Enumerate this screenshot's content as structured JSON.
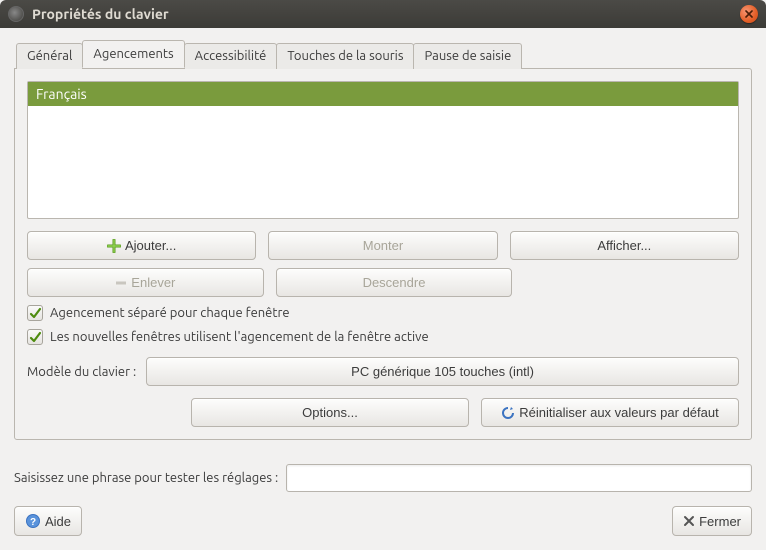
{
  "window": {
    "title": "Propriétés du clavier"
  },
  "tabs": [
    {
      "label": "Général"
    },
    {
      "label": "Agencements"
    },
    {
      "label": "Accessibilité"
    },
    {
      "label": "Touches de la souris"
    },
    {
      "label": "Pause de saisie"
    }
  ],
  "active_tab_index": 1,
  "layouts": {
    "items": [
      {
        "name": "Français"
      }
    ],
    "add_label": "Ajouter...",
    "remove_label": "Enlever",
    "up_label": "Monter",
    "down_label": "Descendre",
    "show_label": "Afficher..."
  },
  "checks": {
    "separate": {
      "checked": true,
      "label": "Agencement séparé pour chaque fenêtre"
    },
    "newwin": {
      "checked": true,
      "label": "Les nouvelles fenêtres utilisent l'agencement de la fenêtre active"
    }
  },
  "model": {
    "label": "Modèle du clavier :",
    "value": "PC générique 105 touches (intl)"
  },
  "options_label": "Options...",
  "reset_label": "Réinitialiser aux valeurs par défaut",
  "test": {
    "label": "Saisissez une phrase pour tester les réglages :",
    "value": ""
  },
  "footer": {
    "help_label": "Aide",
    "close_label": "Fermer"
  }
}
